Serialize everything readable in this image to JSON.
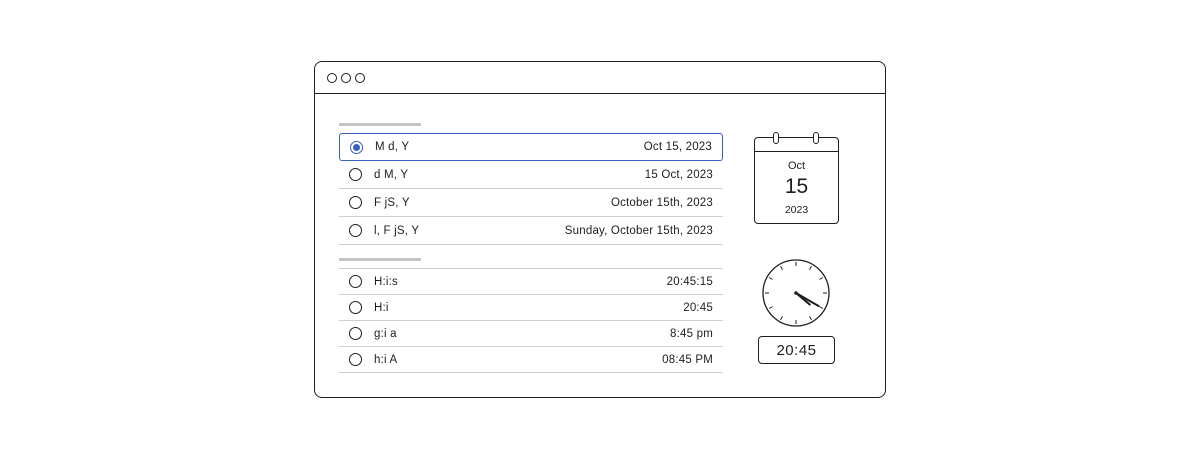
{
  "date_formats": [
    {
      "format": "M d, Y",
      "value": "Oct 15, 2023",
      "selected": true
    },
    {
      "format": "d M, Y",
      "value": "15 Oct, 2023",
      "selected": false
    },
    {
      "format": "F jS, Y",
      "value": "October 15th, 2023",
      "selected": false
    },
    {
      "format": "l, F jS, Y",
      "value": "Sunday, October 15th, 2023",
      "selected": false
    }
  ],
  "time_formats": [
    {
      "format": "H:i:s",
      "value": "20:45:15",
      "selected": false
    },
    {
      "format": "H:i",
      "value": "20:45",
      "selected": false
    },
    {
      "format": "g:i a",
      "value": "8:45 pm",
      "selected": false
    },
    {
      "format": "h:i A",
      "value": "08:45 PM",
      "selected": false
    }
  ],
  "calendar": {
    "month": "Oct",
    "day": "15",
    "year": "2023"
  },
  "clock": {
    "digital": "20:45",
    "hour": 4,
    "minute": 20
  },
  "colors": {
    "accent": "#3a5fc2",
    "stroke": "#1e1e1e",
    "divider": "#d0d0d0"
  },
  "icons": {
    "calendar": "calendar-icon",
    "clock": "analog-clock-icon"
  }
}
